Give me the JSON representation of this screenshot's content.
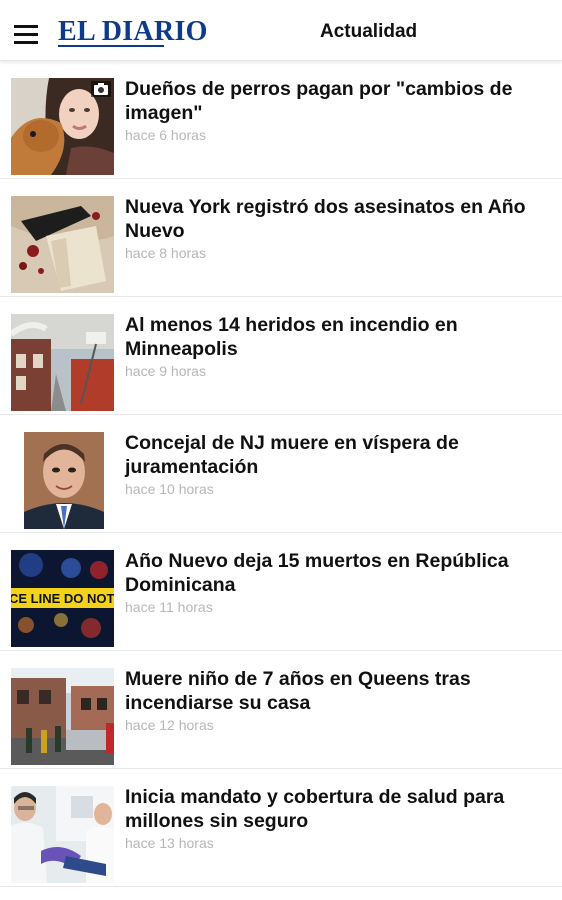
{
  "header": {
    "logo": "EL DIARIO",
    "section": "Actualidad"
  },
  "articles": [
    {
      "headline": "Dueños de perros pagan por \"cambios de imagen\"",
      "time": "hace 6 horas",
      "thumb_icon": "camera-icon"
    },
    {
      "headline": "Nueva York registró dos asesinatos en Año Nuevo",
      "time": "hace 8 horas"
    },
    {
      "headline": "Al menos 14 heridos en incendio en Minneapolis",
      "time": "hace 9 horas"
    },
    {
      "headline": "Concejal de NJ muere en víspera de juramentación",
      "time": "hace 10 horas"
    },
    {
      "headline": "Año Nuevo deja 15 muertos en República Dominicana",
      "time": "hace 11 horas",
      "thumb_text": "CE LINE DO NOT CR"
    },
    {
      "headline": "Muere niño de 7 años en Queens tras incendiarse su casa",
      "time": "hace 12 horas"
    },
    {
      "headline": "Inicia mandato y cobertura de salud para millones sin seguro",
      "time": "hace 13 horas"
    }
  ]
}
